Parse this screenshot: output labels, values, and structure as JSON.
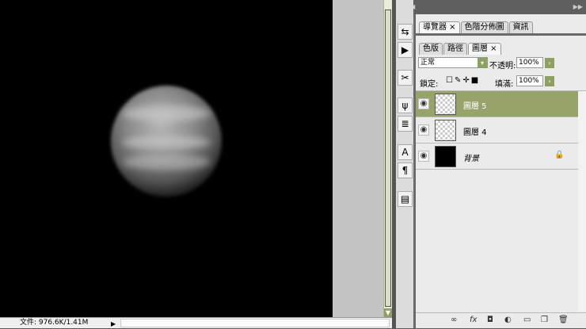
{
  "status": {
    "file_info": "文件: 976.6K/1.41M"
  },
  "top_panel": {
    "tabs": [
      {
        "label": "導覽器"
      },
      {
        "label": "色階分佈圖"
      },
      {
        "label": "資訊"
      }
    ]
  },
  "layers_panel": {
    "tabs": [
      {
        "label": "色版"
      },
      {
        "label": "路徑"
      },
      {
        "label": "圖層"
      }
    ],
    "blend_mode": "正常",
    "opacity_label": "不透明:",
    "opacity": "100%",
    "lock_label": "鎖定:",
    "fill_label": "填滿:",
    "fill": "100%",
    "layers": [
      {
        "name": "圖層 5",
        "selected": true
      },
      {
        "name": "圖層 4",
        "selected": false
      },
      {
        "name": "背景",
        "selected": false,
        "locked": true
      }
    ]
  },
  "colors": {
    "accent": "#96a46a"
  }
}
